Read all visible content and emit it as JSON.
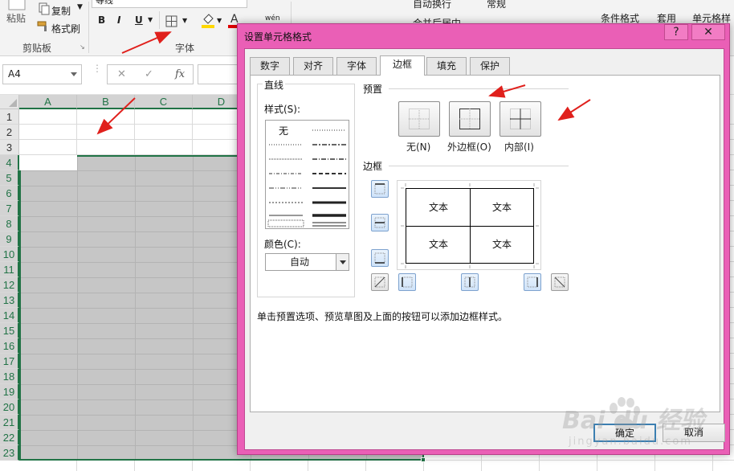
{
  "ribbon": {
    "clipboard": {
      "paste_label": "粘贴",
      "copy_label": "复制",
      "format_painter_label": "格式刷",
      "group_label": "剪贴板"
    },
    "font": {
      "font_name": "等线",
      "bold": "B",
      "italic": "I",
      "underline": "U",
      "phonetic": "wén",
      "group_label": "字体"
    },
    "alignment": {
      "wrap_label": "自动换行",
      "merge_label": "合并后居中"
    },
    "number": {
      "format_value": "常规"
    },
    "styles": {
      "conditional_label": "条件格式",
      "table_label": "套用",
      "cell_style_label": "单元格样"
    },
    "colors": {
      "fill": "#ffd800",
      "font": "#e00000"
    }
  },
  "formula_bar": {
    "name_box": "A4",
    "cancel_symbol": "✕",
    "enter_symbol": "✓",
    "fx_label": "fx"
  },
  "sheet": {
    "columns": [
      "A",
      "B",
      "C",
      "D"
    ],
    "rows": [
      "1",
      "2",
      "3",
      "4",
      "5",
      "6",
      "7",
      "8",
      "9",
      "10",
      "11",
      "12",
      "13",
      "14",
      "15",
      "16",
      "17",
      "18",
      "19",
      "20",
      "21",
      "22",
      "23"
    ],
    "selection_range": "A4:G23"
  },
  "dialog": {
    "title": "设置单元格格式",
    "help_symbol": "?",
    "close_symbol": "✕",
    "tabs": [
      "数字",
      "对齐",
      "字体",
      "边框",
      "填充",
      "保护"
    ],
    "active_tab": "边框",
    "line_section": "直线",
    "style_label": "样式(S):",
    "none_style": "无",
    "color_label": "颜色(C):",
    "color_value": "自动",
    "preset_section": "预置",
    "presets": [
      "无(N)",
      "外边框(O)",
      "内部(I)"
    ],
    "border_section": "边框",
    "preview_text": [
      "文本",
      "文本",
      "文本",
      "文本"
    ],
    "hint": "单击预置选项、预览草图及上面的按钮可以添加边框样式。",
    "ok_label": "确定",
    "cancel_label": "取消"
  },
  "watermark": {
    "brand": "Bai du 经验",
    "url": "jingyan.baidu.com"
  },
  "annotation_color": "#e0201c"
}
